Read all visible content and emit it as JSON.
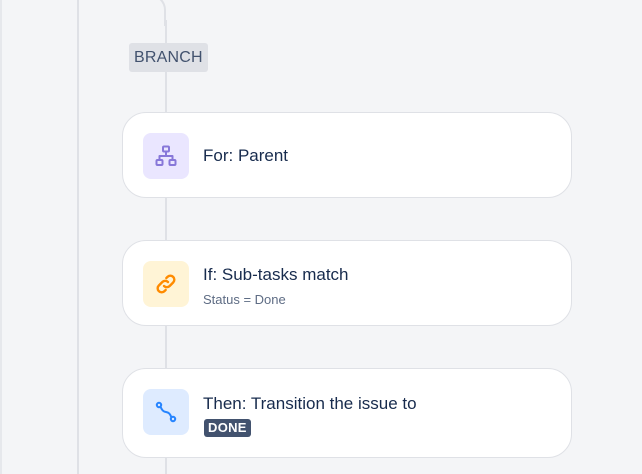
{
  "branch": {
    "label": "BRANCH"
  },
  "steps": [
    {
      "type": "branch-rule",
      "icon": "hierarchy-icon",
      "icon_color": "#8777d9",
      "icon_bg": "#eae6ff",
      "title": "For: Parent"
    },
    {
      "type": "condition",
      "icon": "link-icon",
      "icon_color": "#ff8b00",
      "icon_bg": "#fff4d6",
      "title": "If: Sub-tasks match",
      "subtitle": "Status = Done"
    },
    {
      "type": "action",
      "icon": "transition-icon",
      "icon_color": "#2684ff",
      "icon_bg": "#deebff",
      "title": "Then: Transition the issue to",
      "status_badge": "DONE",
      "status_badge_color": "#42526e"
    }
  ]
}
